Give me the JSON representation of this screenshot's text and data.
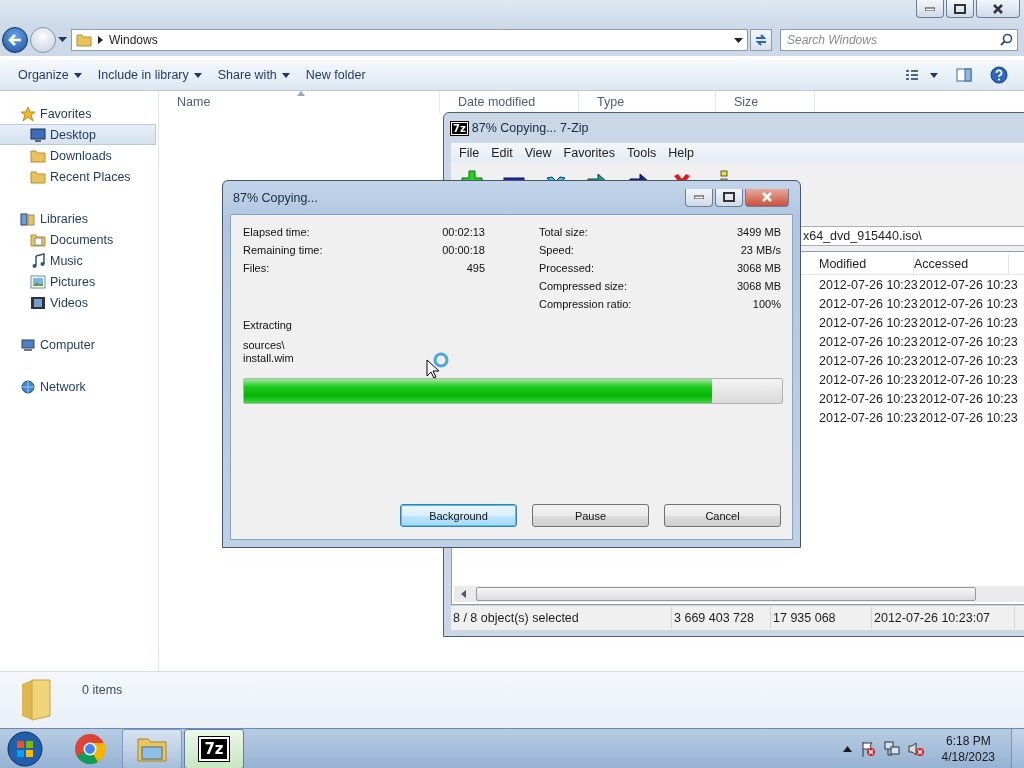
{
  "explorer": {
    "path": "Windows",
    "search": {
      "placeholder": "Search Windows"
    },
    "commands": [
      {
        "label": "Organize",
        "dropdown": true
      },
      {
        "label": "Include in library",
        "dropdown": true
      },
      {
        "label": "Share with",
        "dropdown": true
      },
      {
        "label": "New folder",
        "dropdown": false
      }
    ],
    "navigation": [
      {
        "label": "Favorites",
        "kind": "star",
        "children": [
          {
            "label": "Desktop",
            "kind": "desktop",
            "selected": true
          },
          {
            "label": "Downloads",
            "kind": "folder",
            "selected": false
          },
          {
            "label": "Recent Places",
            "kind": "folder",
            "selected": false
          }
        ]
      },
      {
        "label": "Libraries",
        "kind": "library",
        "children": [
          {
            "label": "Documents",
            "kind": "document",
            "selected": false
          },
          {
            "label": "Music",
            "kind": "music",
            "selected": false
          },
          {
            "label": "Pictures",
            "kind": "picture",
            "selected": false
          },
          {
            "label": "Videos",
            "kind": "video",
            "selected": false
          }
        ]
      },
      {
        "label": "Computer",
        "kind": "computer"
      },
      {
        "label": "Network",
        "kind": "network"
      }
    ],
    "columns": [
      "Name",
      "Date modified",
      "Type",
      "Size"
    ],
    "details": "0 items"
  },
  "sevenzip": {
    "logo": "7z",
    "title": "87% Copying... 7-Zip",
    "menu": [
      "File",
      "Edit",
      "View",
      "Favorites",
      "Tools",
      "Help"
    ],
    "path": "x64_dvd_915440.iso\\",
    "columns": [
      "Modified",
      "Accessed"
    ],
    "rows": [
      {
        "modified": "2012-07-26 10:23",
        "accessed": "2012-07-26 10:23"
      },
      {
        "modified": "2012-07-26 10:23",
        "accessed": "2012-07-26 10:23"
      },
      {
        "modified": "2012-07-26 10:23",
        "accessed": "2012-07-26 10:23"
      },
      {
        "modified": "2012-07-26 10:23",
        "accessed": "2012-07-26 10:23"
      },
      {
        "modified": "2012-07-26 10:23",
        "accessed": "2012-07-26 10:23"
      },
      {
        "modified": "2012-07-26 10:23",
        "accessed": "2012-07-26 10:23"
      },
      {
        "modified": "2012-07-26 10:23",
        "accessed": "2012-07-26 10:23"
      },
      {
        "modified": "2012-07-26 10:23",
        "accessed": "2012-07-26 10:23"
      }
    ],
    "status": [
      "8 / 8 object(s) selected",
      "3 669 403 728",
      "17 935 068",
      "2012-07-26 10:23:07"
    ]
  },
  "dialog": {
    "title": "87% Copying...",
    "stats_left": [
      {
        "label": "Elapsed time:",
        "value": "00:02:13"
      },
      {
        "label": "Remaining time:",
        "value": "00:00:18"
      },
      {
        "label": "Files:",
        "value": "495"
      }
    ],
    "stats_right": [
      {
        "label": "Total size:",
        "value": "3499 MB"
      },
      {
        "label": "Speed:",
        "value": "23 MB/s"
      },
      {
        "label": "Processed:",
        "value": "3068 MB"
      },
      {
        "label": "Compressed size:",
        "value": "3068 MB"
      },
      {
        "label": "Compression ratio:",
        "value": "100%"
      }
    ],
    "operation": "Extracting",
    "file_path": [
      "sources\\",
      "install.wim"
    ],
    "progress": {
      "level": 0.87
    },
    "buttons": [
      {
        "label": "Background",
        "selected": true
      },
      {
        "label": "Pause",
        "selected": false
      },
      {
        "label": "Cancel",
        "selected": false
      }
    ]
  },
  "taskbar": {
    "apps": [
      {
        "kind": "browser",
        "selected": false
      },
      {
        "kind": "explorer",
        "selected": false
      },
      {
        "kind": "sevenzip",
        "label": "7z",
        "selected": true
      }
    ],
    "time": "6:18 PM",
    "date": "4/18/2023"
  }
}
